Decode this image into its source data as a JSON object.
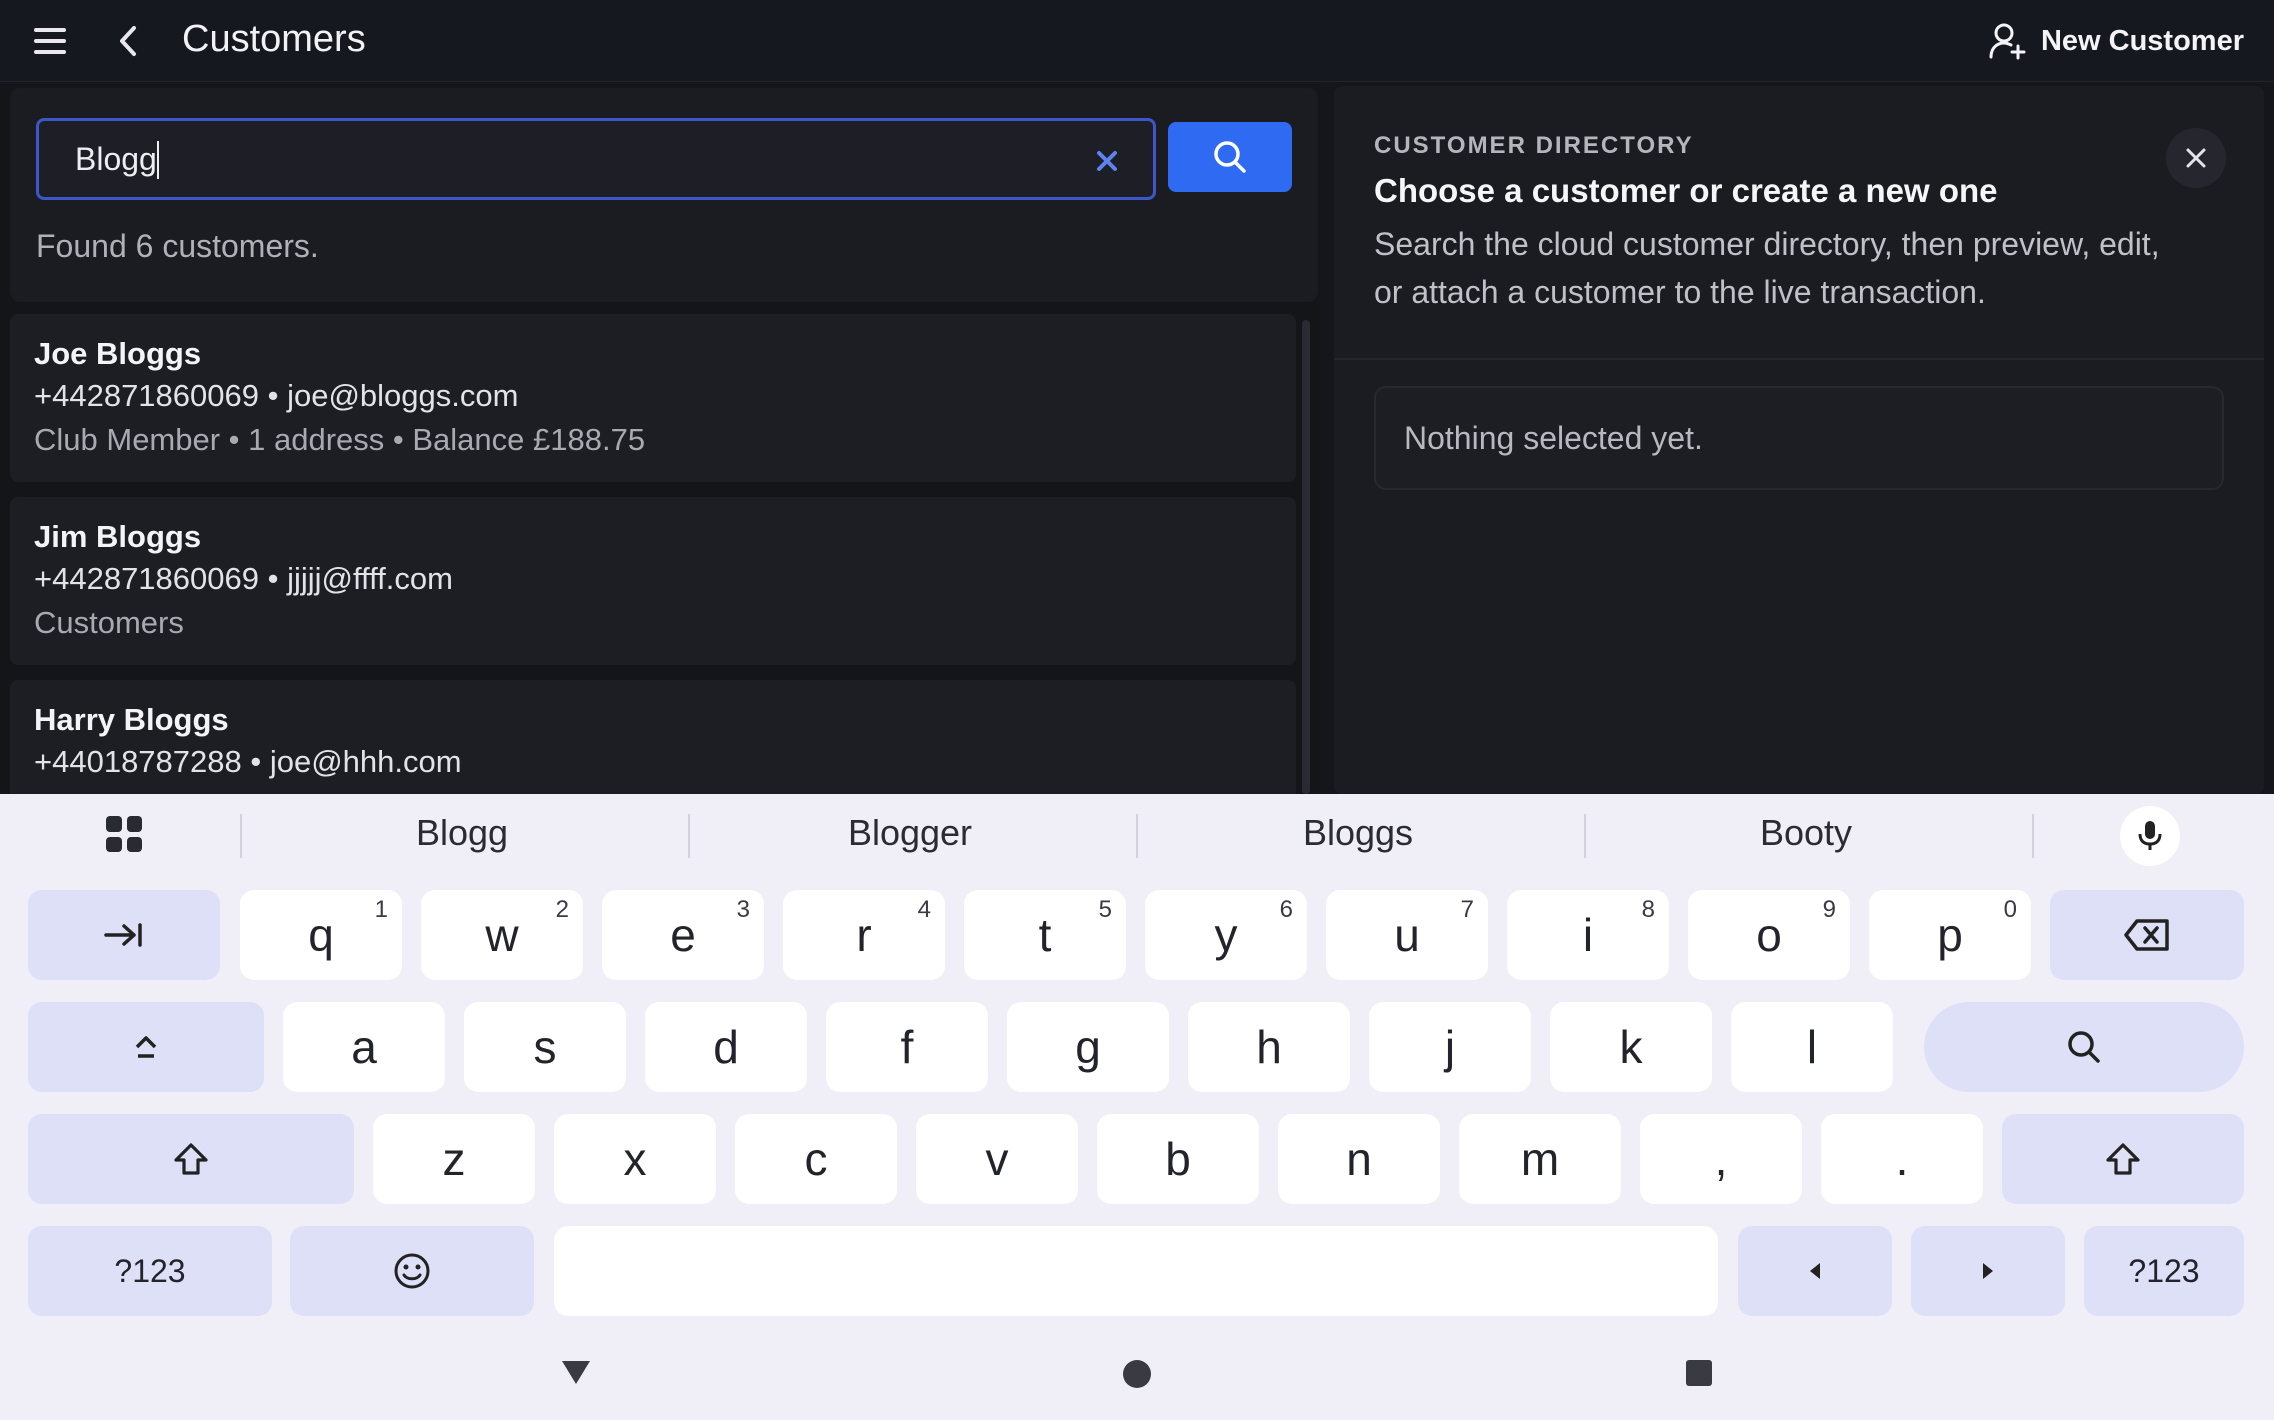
{
  "appbar": {
    "title": "Customers",
    "new_customer_label": "New Customer"
  },
  "search": {
    "value": "Blogg",
    "found_text": "Found 6 customers."
  },
  "results": [
    {
      "name": "Joe Bloggs",
      "contact": "+442871860069 • joe@bloggs.com",
      "meta": "Club Member • 1 address • Balance £188.75"
    },
    {
      "name": "Jim Bloggs",
      "contact": "+442871860069 • jjjjj@ffff.com",
      "meta": "Customers"
    },
    {
      "name": "Harry Bloggs",
      "contact": "+44018787288 • joe@hhh.com",
      "meta": ""
    }
  ],
  "detail": {
    "kicker": "CUSTOMER DIRECTORY",
    "heading": "Choose a customer or create a new one",
    "description": "Search the cloud customer directory, then preview, edit, or attach a customer to the live transaction.",
    "empty_text": "Nothing selected yet."
  },
  "keyboard": {
    "suggestions": [
      "Blogg",
      "Blogger",
      "Bloggs",
      "Booty"
    ],
    "row1": [
      {
        "k": "q",
        "n": "1"
      },
      {
        "k": "w",
        "n": "2"
      },
      {
        "k": "e",
        "n": "3"
      },
      {
        "k": "r",
        "n": "4"
      },
      {
        "k": "t",
        "n": "5"
      },
      {
        "k": "y",
        "n": "6"
      },
      {
        "k": "u",
        "n": "7"
      },
      {
        "k": "i",
        "n": "8"
      },
      {
        "k": "o",
        "n": "9"
      },
      {
        "k": "p",
        "n": "0"
      }
    ],
    "row2": [
      "a",
      "s",
      "d",
      "f",
      "g",
      "h",
      "j",
      "k",
      "l"
    ],
    "row3": [
      "z",
      "x",
      "c",
      "v",
      "b",
      "n",
      "m",
      ",",
      "."
    ],
    "symbols_label": "?123"
  },
  "colors": {
    "accent": "#2f6bf2",
    "keyboard_bg": "#f0eef6",
    "function_key": "#dde0f6"
  }
}
